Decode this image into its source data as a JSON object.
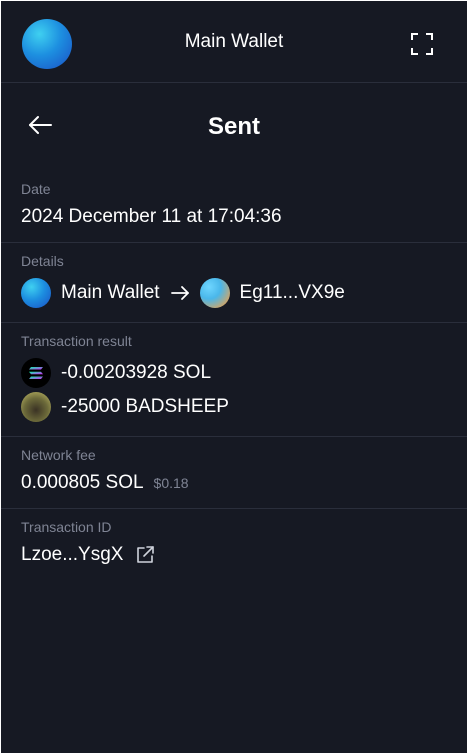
{
  "header": {
    "wallet_title": "Main Wallet"
  },
  "page": {
    "title": "Sent"
  },
  "date": {
    "label": "Date",
    "value": "2024 December 11 at 17:04:36"
  },
  "details": {
    "label": "Details",
    "from": "Main Wallet",
    "to": "Eg11...VX9e"
  },
  "result": {
    "label": "Transaction result",
    "items": [
      {
        "icon": "solana-icon",
        "text": "-0.00203928 SOL"
      },
      {
        "icon": "badsheep-token-icon",
        "text": "-25000 BADSHEEP"
      }
    ]
  },
  "fee": {
    "label": "Network fee",
    "value": "0.000805 SOL",
    "usd": "$0.18"
  },
  "txid": {
    "label": "Transaction ID",
    "value": "Lzoe...YsgX"
  },
  "colors": {
    "background": "#161923",
    "muted": "#7f8494",
    "divider": "#2a2e3b"
  }
}
